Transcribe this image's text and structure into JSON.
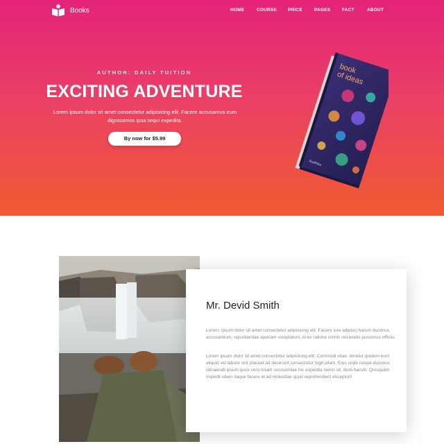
{
  "brand": {
    "name": "Books",
    "icon": "open-book-icon"
  },
  "nav": {
    "items": [
      "HOME",
      "COURSE",
      "PRICE",
      "PAGES",
      "FACT",
      "ABOUT"
    ]
  },
  "hero": {
    "author": "AUTHOR: DAILY TUITION",
    "title": "EXCITING ADVENTURE",
    "description": "Lorem ipsum dolor sit amet consectetur adipisicing elit. Facere accusamus eum dignissimos ipsa sequi expedita.",
    "cta": "By now for $5.99",
    "book": {
      "title_line1": "book",
      "title_line2": "of ideas",
      "author": "Radhika"
    }
  },
  "about": {
    "name": "Mr. Devid Smith",
    "paragraphs": [
      "Lorem, ipsum dolor sit amet consectetur adipisicing elit. Facere iure adipisci harum ducimus accusantium, repudiandae aperiam voluptatum, id ex ratione omnis reiciendis possimus officiis.",
      "Lorem ipsum dolor sit amet consectetur adipisicing elit. Commodi vitae, tenetur quidem eum aliquid vel labore sint placeat ad deserunt consectetur fugit ullam. Eius unde neque ducimus obcaecati ipsum quos vero totam recusandae hic expedita nemo sit, illum harum. Quisquam impedit ullam itaque facere et ad molestiae quod reprehenderit excepturi!"
    ]
  },
  "colors": {
    "gradient_top": "#e4237a",
    "gradient_mid": "#ea3f66",
    "gradient_bottom": "#f05b32",
    "book_cover": "#2c2560"
  }
}
